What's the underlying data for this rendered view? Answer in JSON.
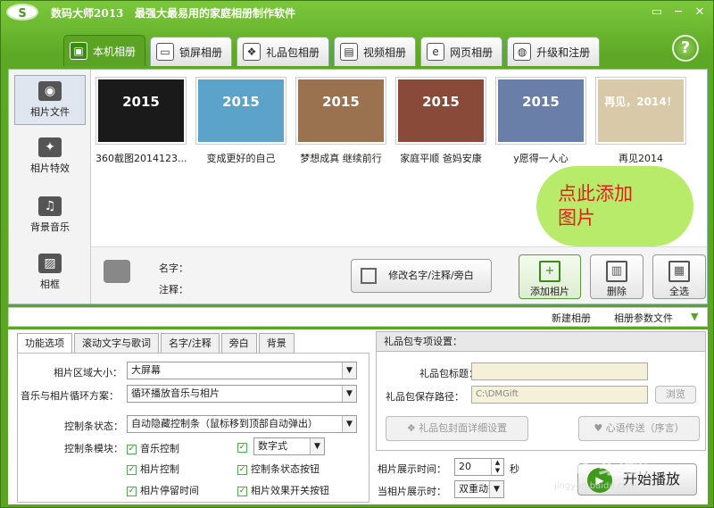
{
  "title": {
    "logo": "S",
    "app": "数码大师2013",
    "slogan": "最强大最易用的家庭相册制作软件"
  },
  "window_buttons": [
    "▭",
    "─",
    "✕"
  ],
  "tabs": [
    {
      "label": "本机相册",
      "icon": "photo-album-icon",
      "active": true
    },
    {
      "label": "锁屏相册",
      "icon": "monitor-icon"
    },
    {
      "label": "礼品包相册",
      "icon": "gift-icon"
    },
    {
      "label": "视频相册",
      "icon": "film-icon"
    },
    {
      "label": "网页相册",
      "icon": "ie-icon"
    },
    {
      "label": "升级和注册",
      "icon": "globe-icon"
    }
  ],
  "help": "?",
  "sidebar": [
    {
      "label": "相片文件",
      "icon": "camera-icon",
      "active": true
    },
    {
      "label": "相片特效",
      "icon": "sparkle-icon"
    },
    {
      "label": "背景音乐",
      "icon": "music-icon"
    },
    {
      "label": "相框",
      "icon": "frame-icon"
    }
  ],
  "photos": [
    {
      "caption": "360截图2014123...",
      "text": "2015",
      "color": "#1a1a1a"
    },
    {
      "caption": "变成更好的自己",
      "text": "2015",
      "color": "#5ba3c8"
    },
    {
      "caption": "梦想成真  继续前行",
      "text": "2015",
      "color": "#9a7250"
    },
    {
      "caption": "家庭平顺  爸妈安康",
      "text": "2015",
      "color": "#8a4a3a"
    },
    {
      "caption": "y愿得一人心",
      "text": "2015",
      "color": "#6a7fa8"
    },
    {
      "caption": "再见2014",
      "text": "再见，2014！",
      "color": "#d8c9a8"
    }
  ],
  "info": {
    "name_label": "名字：",
    "note_label": "注释：",
    "edit_button": "修改名字/注释/旁白"
  },
  "actions": {
    "add": "添加相片",
    "delete": "删除",
    "select_all": "全选"
  },
  "callout": {
    "line1": "点此添加",
    "line2": "图片"
  },
  "toolbar2": {
    "new_album": "新建相册",
    "param_file": "相册参数文件"
  },
  "lower_tabs": [
    "功能选项",
    "滚动文字与歌词",
    "名字/注释",
    "旁白",
    "背景"
  ],
  "options": {
    "area_label": "相片区域大小：",
    "area_value": "大屏幕",
    "loop_label": "音乐与相片循环方案：",
    "loop_value": "循环播放音乐与相片",
    "ctrl_state_label": "控制条状态：",
    "ctrl_state_value": "自动隐藏控制条（鼠标移到顶部自动弹出）",
    "ctrl_module_label": "控制条模块：",
    "checks": [
      "音乐控制",
      "数字式",
      "相片控制",
      "控制条状态按钮",
      "相片停留时间",
      "相片效果开关按钮"
    ]
  },
  "gift": {
    "header": "礼品包专项设置：",
    "title_label": "礼品包标题：",
    "title_value": "",
    "path_label": "礼品包保存路径：",
    "path_value": "C:\\DMGift",
    "browse": "浏览",
    "cover": "礼品包封面详细设置",
    "heart": "心语传送（序言）"
  },
  "timing": {
    "show_time_label": "相片展示时间：",
    "show_time_value": "20",
    "unit": "秒",
    "when_label": "当相片展示时：",
    "when_value": "双重动态"
  },
  "start": "开始播放",
  "watermark": {
    "main": "Bai 经验",
    "sub": "jingyan.baidu.com"
  }
}
